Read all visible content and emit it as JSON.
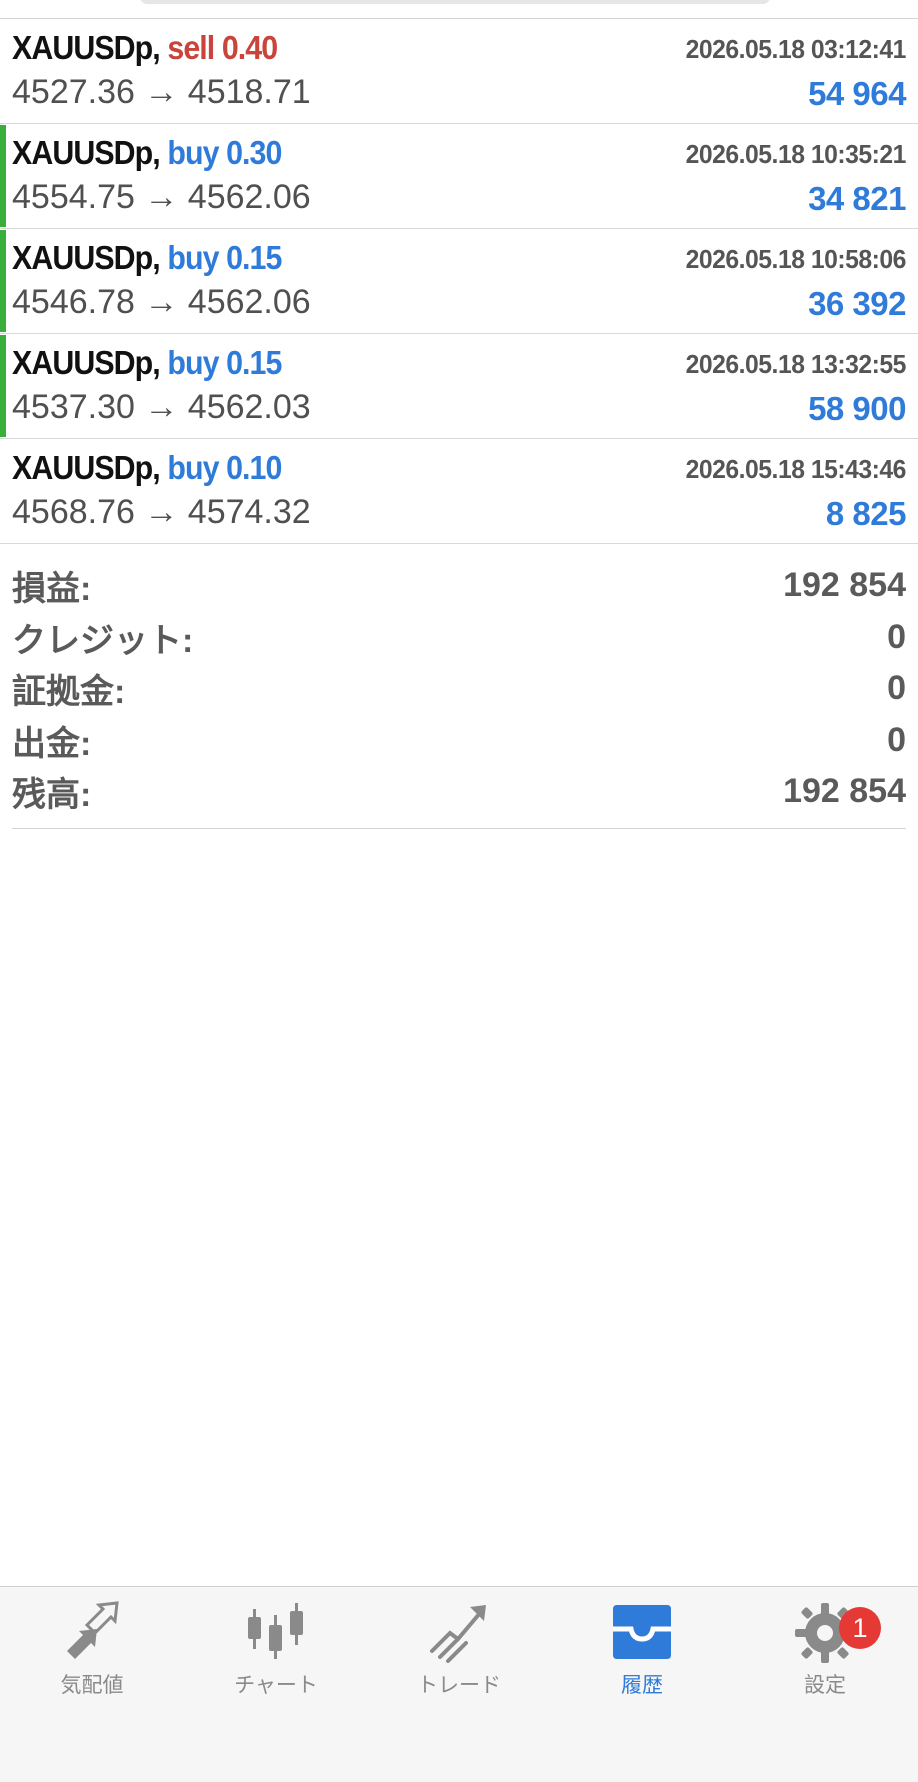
{
  "colors": {
    "buy": "#2f7bd9",
    "sell": "#c9443a",
    "profit": "#2f7bd9",
    "open_bar": "#3aae3a",
    "tab_active": "#2f7bd9",
    "tab_inactive": "#8a8a8a",
    "badge": "#e53935"
  },
  "deals": [
    {
      "symbol": "XAUUSDp,",
      "side": "sell 0.40",
      "type": "sell",
      "time": "2026.05.18 03:12:41",
      "prices": "4527.36 → 4518.71",
      "profit": "54 964",
      "open_bar": false
    },
    {
      "symbol": "XAUUSDp,",
      "side": "buy 0.30",
      "type": "buy",
      "time": "2026.05.18 10:35:21",
      "prices": "4554.75 → 4562.06",
      "profit": "34 821",
      "open_bar": true
    },
    {
      "symbol": "XAUUSDp,",
      "side": "buy 0.15",
      "type": "buy",
      "time": "2026.05.18 10:58:06",
      "prices": "4546.78 → 4562.06",
      "profit": "36 392",
      "open_bar": true
    },
    {
      "symbol": "XAUUSDp,",
      "side": "buy 0.15",
      "type": "buy",
      "time": "2026.05.18 13:32:55",
      "prices": "4537.30 → 4562.03",
      "profit": "58 900",
      "open_bar": true
    },
    {
      "symbol": "XAUUSDp,",
      "side": "buy 0.10",
      "type": "buy",
      "time": "2026.05.18 15:43:46",
      "prices": "4568.76 → 4574.32",
      "profit": "8 825",
      "open_bar": false
    }
  ],
  "summary": {
    "profit": {
      "label": "損益:",
      "value": "192 854"
    },
    "credit": {
      "label": "クレジット:",
      "value": "0"
    },
    "margin": {
      "label": "証拠金:",
      "value": "0"
    },
    "withdrawal": {
      "label": "出金:",
      "value": "0"
    },
    "balance": {
      "label": "残高:",
      "value": "192 854"
    }
  },
  "tabbar": {
    "quotes": {
      "label": "気配値",
      "icon": "quotes-arrows-icon"
    },
    "chart": {
      "label": "チャート",
      "icon": "candlestick-icon"
    },
    "trade": {
      "label": "トレード",
      "icon": "trade-trend-icon"
    },
    "history": {
      "label": "履歴",
      "icon": "inbox-tray-icon",
      "active": true
    },
    "settings": {
      "label": "設定",
      "icon": "gear-icon",
      "badge": "1"
    }
  }
}
